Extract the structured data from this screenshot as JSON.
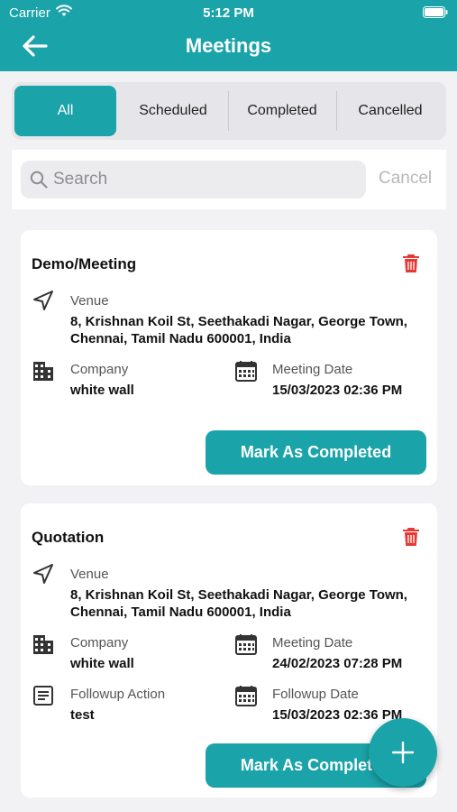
{
  "status_bar": {
    "carrier": "Carrier",
    "time": "5:12 PM"
  },
  "header": {
    "title": "Meetings"
  },
  "tabs": [
    {
      "label": "All",
      "active": true
    },
    {
      "label": "Scheduled",
      "active": false
    },
    {
      "label": "Completed",
      "active": false
    },
    {
      "label": "Cancelled",
      "active": false
    }
  ],
  "search": {
    "placeholder": "Search",
    "value": "",
    "cancel_label": "Cancel"
  },
  "meetings": [
    {
      "title": "Demo/Meeting",
      "venue_label": "Venue",
      "venue": "8, Krishnan Koil St, Seethakadi Nagar, George Town, Chennai, Tamil Nadu 600001, India",
      "company_label": "Company",
      "company": "white wall",
      "meeting_date_label": "Meeting Date",
      "meeting_date": "15/03/2023 02:36 PM",
      "action_label": "Mark As Completed"
    },
    {
      "title": "Quotation",
      "venue_label": "Venue",
      "venue": "8, Krishnan Koil St, Seethakadi Nagar, George Town, Chennai, Tamil Nadu 600001, India",
      "company_label": "Company",
      "company": "white wall",
      "meeting_date_label": "Meeting Date",
      "meeting_date": "24/02/2023 07:28 PM",
      "followup_action_label": "Followup Action",
      "followup_action": "test",
      "followup_date_label": "Followup Date",
      "followup_date": "15/03/2023 02:36 PM",
      "action_label": "Mark As Completed"
    }
  ],
  "colors": {
    "primary": "#1aa3a8",
    "danger": "#e53935",
    "background": "#f2f2f4"
  },
  "icons": {
    "back": "arrow-left-icon",
    "search": "search-icon",
    "delete": "trash-icon",
    "venue": "navigation-arrow-icon",
    "company": "building-icon",
    "date": "calendar-icon",
    "followup": "note-icon",
    "add": "plus-icon"
  }
}
